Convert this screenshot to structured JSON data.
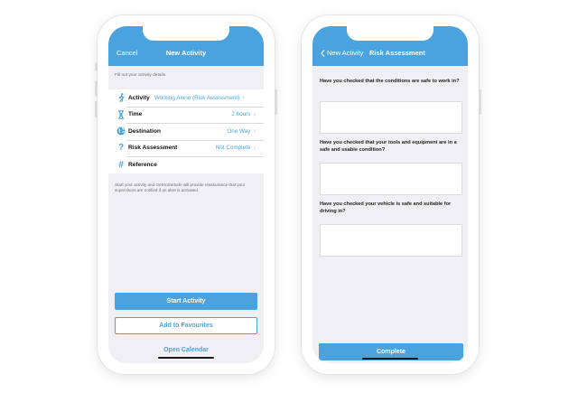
{
  "colors": {
    "accent": "#4aa3df",
    "background": "#efeff4"
  },
  "new_activity": {
    "nav": {
      "cancel_label": "Cancel",
      "title": "New Activity"
    },
    "hint": "Fill out your activity details.",
    "rows": [
      {
        "icon": "walking-person-icon",
        "label": "Activity",
        "value": "Working Alone (Risk Assessment)"
      },
      {
        "icon": "hourglass-icon",
        "label": "Time",
        "value": "2 hours"
      },
      {
        "icon": "globe-icon",
        "label": "Destination",
        "value": "One Way"
      },
      {
        "icon": "question-mark-icon",
        "label": "Risk Assessment",
        "value": "Not Complete"
      },
      {
        "icon": "hashtag-icon",
        "label": "Reference",
        "value": ""
      }
    ],
    "info": "Start your activity and GetHomeSafe will provide reassurance that your supervisors are notified if an alert is activated.",
    "buttons": {
      "start": "Start Activity",
      "favourites": "Add to Favourites",
      "calendar": "Open Calendar"
    }
  },
  "risk_assessment": {
    "nav": {
      "back_label": "New Activity",
      "title": "Risk Assessment"
    },
    "questions": [
      {
        "text": "Have you checked that the conditions are safe to work in?",
        "answer": ""
      },
      {
        "text": "Have you checked that your tools and equipment are in a safe and usable condition?",
        "answer": ""
      },
      {
        "text": "Have you checked your vehicle is safe and suitable for driving in?",
        "answer": ""
      }
    ],
    "complete_label": "Complete"
  }
}
